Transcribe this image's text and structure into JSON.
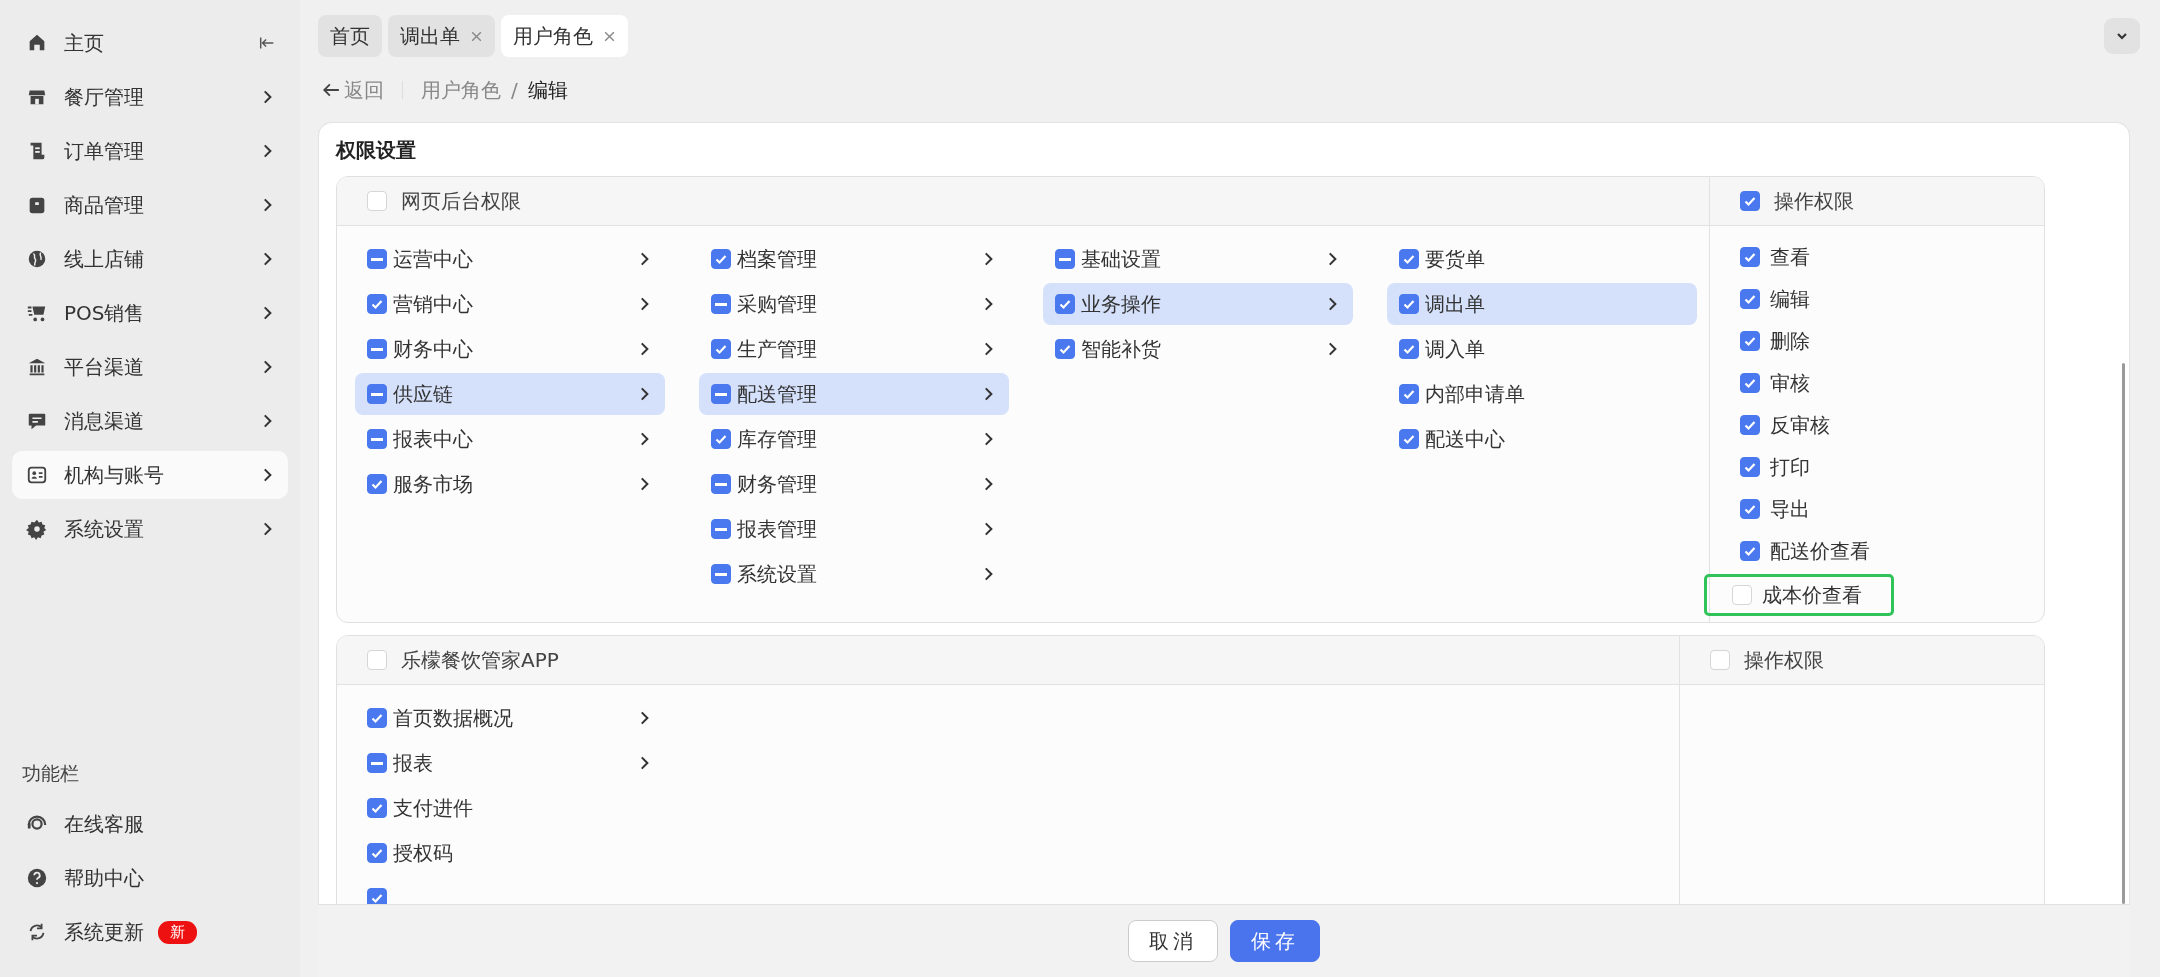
{
  "sidebar": {
    "items": [
      {
        "label": "主页",
        "expandable": false,
        "selected": false
      },
      {
        "label": "餐厅管理",
        "expandable": true,
        "selected": false
      },
      {
        "label": "订单管理",
        "expandable": true,
        "selected": false
      },
      {
        "label": "商品管理",
        "expandable": true,
        "selected": false
      },
      {
        "label": "线上店铺",
        "expandable": true,
        "selected": false
      },
      {
        "label": "POS销售",
        "expandable": true,
        "selected": false
      },
      {
        "label": "平台渠道",
        "expandable": true,
        "selected": false
      },
      {
        "label": "消息渠道",
        "expandable": true,
        "selected": false
      },
      {
        "label": "机构与账号",
        "expandable": true,
        "selected": true
      },
      {
        "label": "系统设置",
        "expandable": true,
        "selected": false
      }
    ],
    "section_title": "功能栏",
    "tools": [
      {
        "label": "在线客服"
      },
      {
        "label": "帮助中心"
      },
      {
        "label": "系统更新",
        "badge": "新"
      }
    ]
  },
  "tabs": [
    {
      "label": "首页",
      "closable": false,
      "selected": false
    },
    {
      "label": "调出单",
      "closable": true,
      "selected": false
    },
    {
      "label": "用户角色",
      "closable": true,
      "selected": true
    }
  ],
  "breadcrumb": {
    "back": "返回",
    "items": [
      "用户角色",
      "编辑"
    ],
    "separator": "/"
  },
  "card": {
    "title": "权限设置",
    "panels": [
      {
        "title": "网页后台权限",
        "checked": false,
        "indeterminate": false,
        "columns": [
          [
            {
              "label": "运营中心",
              "checked": true,
              "indeterminate": true,
              "expandable": true,
              "selected": false
            },
            {
              "label": "营销中心",
              "checked": true,
              "indeterminate": false,
              "expandable": true,
              "selected": false
            },
            {
              "label": "财务中心",
              "checked": true,
              "indeterminate": true,
              "expandable": true,
              "selected": false
            },
            {
              "label": "供应链",
              "checked": true,
              "indeterminate": true,
              "expandable": true,
              "selected": true
            },
            {
              "label": "报表中心",
              "checked": true,
              "indeterminate": true,
              "expandable": true,
              "selected": false
            },
            {
              "label": "服务市场",
              "checked": true,
              "indeterminate": false,
              "expandable": true,
              "selected": false
            }
          ],
          [
            {
              "label": "档案管理",
              "checked": true,
              "indeterminate": false,
              "expandable": true,
              "selected": false
            },
            {
              "label": "采购管理",
              "checked": true,
              "indeterminate": true,
              "expandable": true,
              "selected": false
            },
            {
              "label": "生产管理",
              "checked": true,
              "indeterminate": false,
              "expandable": true,
              "selected": false
            },
            {
              "label": "配送管理",
              "checked": true,
              "indeterminate": true,
              "expandable": true,
              "selected": true
            },
            {
              "label": "库存管理",
              "checked": true,
              "indeterminate": false,
              "expandable": true,
              "selected": false
            },
            {
              "label": "财务管理",
              "checked": true,
              "indeterminate": true,
              "expandable": true,
              "selected": false
            },
            {
              "label": "报表管理",
              "checked": true,
              "indeterminate": true,
              "expandable": true,
              "selected": false
            },
            {
              "label": "系统设置",
              "checked": true,
              "indeterminate": true,
              "expandable": true,
              "selected": false
            }
          ],
          [
            {
              "label": "基础设置",
              "checked": true,
              "indeterminate": true,
              "expandable": true,
              "selected": false
            },
            {
              "label": "业务操作",
              "checked": true,
              "indeterminate": false,
              "expandable": true,
              "selected": true
            },
            {
              "label": "智能补货",
              "checked": true,
              "indeterminate": false,
              "expandable": true,
              "selected": false
            }
          ],
          [
            {
              "label": "要货单",
              "checked": true,
              "indeterminate": false,
              "expandable": false,
              "selected": false
            },
            {
              "label": "调出单",
              "checked": true,
              "indeterminate": false,
              "expandable": false,
              "selected": true
            },
            {
              "label": "调入单",
              "checked": true,
              "indeterminate": false,
              "expandable": false,
              "selected": false
            },
            {
              "label": "内部申请单",
              "checked": true,
              "indeterminate": false,
              "expandable": false,
              "selected": false
            },
            {
              "label": "配送中心",
              "checked": true,
              "indeterminate": false,
              "expandable": false,
              "selected": false
            }
          ]
        ],
        "operations": {
          "title": "操作权限",
          "checked": true,
          "items": [
            {
              "label": "查看",
              "checked": true,
              "outlined": false
            },
            {
              "label": "编辑",
              "checked": true,
              "outlined": false
            },
            {
              "label": "删除",
              "checked": true,
              "outlined": false
            },
            {
              "label": "审核",
              "checked": true,
              "outlined": false
            },
            {
              "label": "反审核",
              "checked": true,
              "outlined": false
            },
            {
              "label": "打印",
              "checked": true,
              "outlined": false
            },
            {
              "label": "导出",
              "checked": true,
              "outlined": false
            },
            {
              "label": "配送价查看",
              "checked": true,
              "outlined": false
            },
            {
              "label": "成本价查看",
              "checked": false,
              "outlined": true
            }
          ]
        }
      },
      {
        "title": "乐檬餐饮管家APP",
        "checked": false,
        "indeterminate": false,
        "columns": [
          [
            {
              "label": "首页数据概况",
              "checked": true,
              "indeterminate": false,
              "expandable": true,
              "selected": false
            },
            {
              "label": "报表",
              "checked": true,
              "indeterminate": true,
              "expandable": true,
              "selected": false
            },
            {
              "label": "支付进件",
              "checked": true,
              "indeterminate": false,
              "expandable": false,
              "selected": false
            },
            {
              "label": "授权码",
              "checked": true,
              "indeterminate": false,
              "expandable": false,
              "selected": false
            },
            {
              "checked": true,
              "indeterminate": false,
              "expandable": false,
              "selected": false
            }
          ]
        ],
        "operations": {
          "title": "操作权限",
          "checked": false
        }
      }
    ]
  },
  "footer": {
    "buttons": [
      {
        "label": "取消",
        "kind": "secondary"
      },
      {
        "label": "保存",
        "kind": "primary"
      }
    ]
  }
}
